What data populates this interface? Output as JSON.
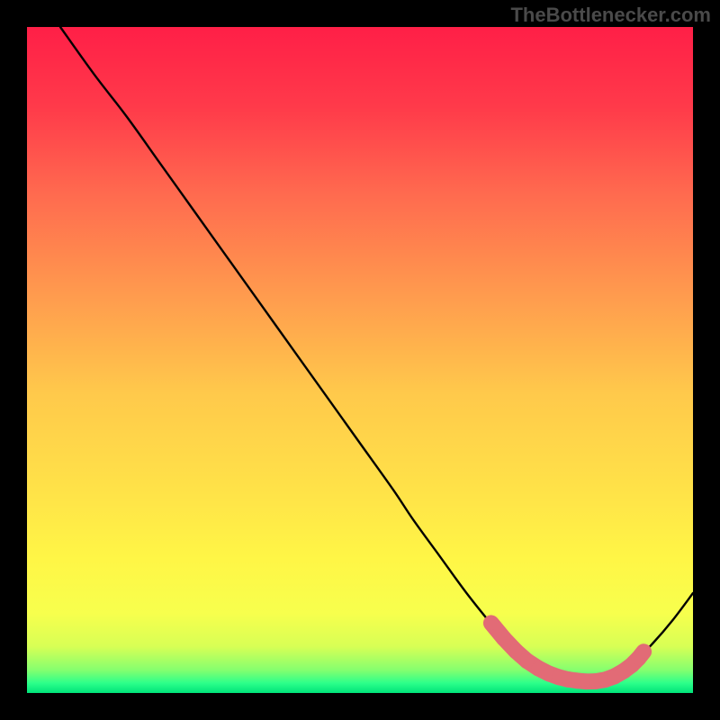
{
  "watermark": "TheBottlenecker.com",
  "plot": {
    "outer_width": 800,
    "outer_height": 800,
    "inner_left": 30,
    "inner_top": 30,
    "inner_width": 740,
    "inner_height": 740
  },
  "gradient_stops": [
    {
      "offset": 0.0,
      "color": "#ff1f47"
    },
    {
      "offset": 0.12,
      "color": "#ff3a4a"
    },
    {
      "offset": 0.25,
      "color": "#ff6a4f"
    },
    {
      "offset": 0.4,
      "color": "#ff9a4e"
    },
    {
      "offset": 0.55,
      "color": "#ffc94b"
    },
    {
      "offset": 0.7,
      "color": "#ffe348"
    },
    {
      "offset": 0.8,
      "color": "#fff646"
    },
    {
      "offset": 0.88,
      "color": "#f7ff4d"
    },
    {
      "offset": 0.93,
      "color": "#d8ff55"
    },
    {
      "offset": 0.965,
      "color": "#86ff6e"
    },
    {
      "offset": 0.985,
      "color": "#2dff8a"
    },
    {
      "offset": 1.0,
      "color": "#00e37a"
    }
  ],
  "chart_data": {
    "type": "line",
    "title": "",
    "xlabel": "",
    "ylabel": "",
    "xlim": [
      0,
      100
    ],
    "ylim": [
      0,
      100
    ],
    "legend": false,
    "series": [
      {
        "name": "bottleneck-curve",
        "x": [
          5,
          10,
          15,
          20,
          25,
          30,
          35,
          40,
          45,
          50,
          55,
          58,
          62,
          66,
          70,
          73,
          76,
          79,
          82,
          85,
          88,
          91,
          94,
          97,
          100
        ],
        "y": [
          100,
          93,
          86.5,
          79.5,
          72.5,
          65.5,
          58.5,
          51.5,
          44.5,
          37.5,
          30.5,
          26,
          20.5,
          15,
          10,
          6.5,
          4,
          2.5,
          1.8,
          1.6,
          2.5,
          4.5,
          7.5,
          11,
          15
        ]
      }
    ],
    "highlight": {
      "name": "optimal-range",
      "color": "#e26b76",
      "dot_radius_frac": 0.01,
      "segment_width_frac": 0.024,
      "points_x": [
        69.7,
        71.6,
        73.4,
        75.1,
        76.8,
        78.4,
        79.8,
        81.2,
        82.6,
        84.0,
        85.4,
        86.8,
        88.2,
        89.6,
        90.8,
        91.8,
        92.6
      ],
      "points_y": [
        10.5,
        8.2,
        6.3,
        4.8,
        3.7,
        2.9,
        2.4,
        2.05,
        1.85,
        1.72,
        1.75,
        2.0,
        2.5,
        3.3,
        4.2,
        5.2,
        6.2
      ]
    }
  }
}
